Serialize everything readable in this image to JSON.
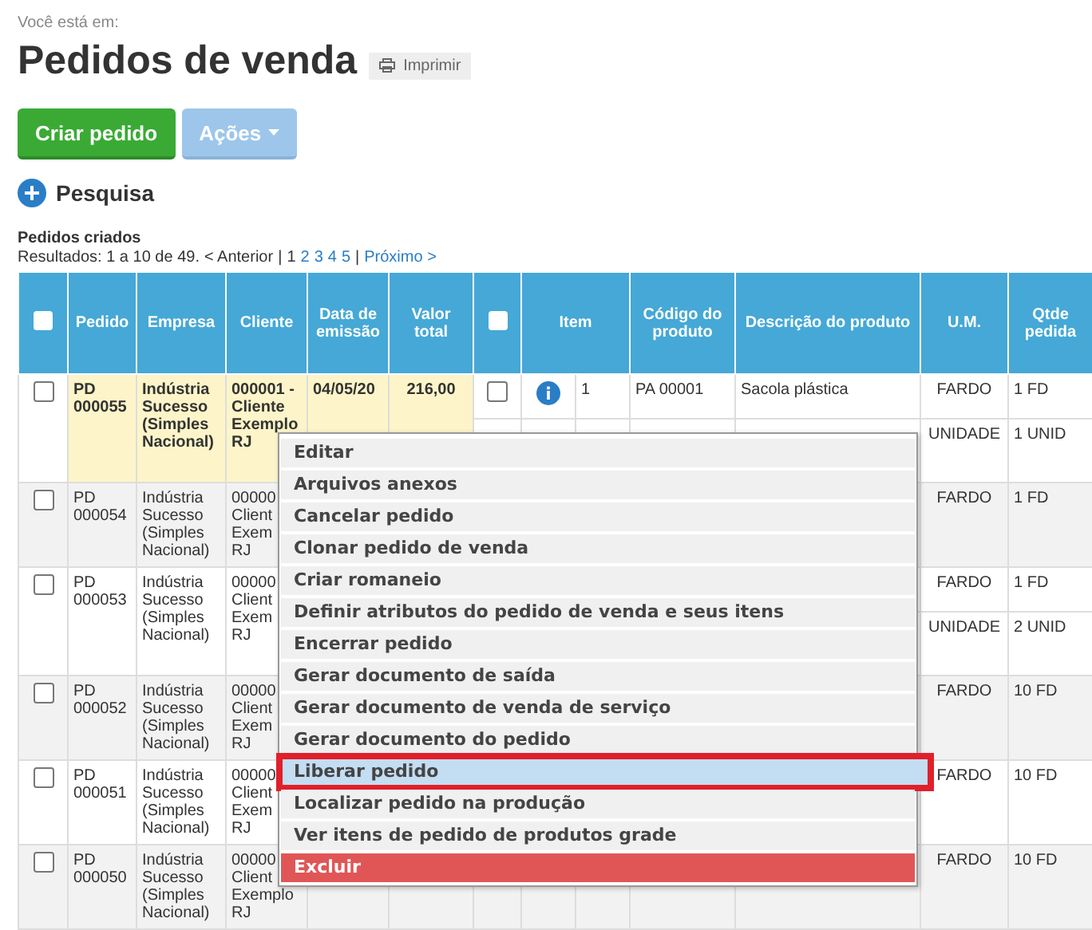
{
  "breadcrumb": "Você está em:",
  "title": "Pedidos de venda",
  "print_button": "Imprimir",
  "buttons": [
    {
      "label": "Criar pedido",
      "kind": "primary"
    },
    {
      "label": "Ações",
      "kind": "dropdown"
    }
  ],
  "search_toggle": "Pesquisa",
  "section_title": "Pedidos criados",
  "pagination": {
    "results": "Resultados: 1 a 10 de 49.",
    "previous": "< Anterior",
    "separators": [
      "|",
      "|"
    ],
    "pages": [
      {
        "label": "1",
        "selected": true
      },
      {
        "label": "2",
        "selected": false
      },
      {
        "label": "3",
        "selected": false
      },
      {
        "label": "4",
        "selected": false
      },
      {
        "label": "5",
        "selected": false
      }
    ],
    "next": "Próximo >"
  },
  "table": {
    "header_checked": false,
    "item_header_checked": false,
    "columns": [
      "Pedido",
      "Empresa",
      "Cliente",
      "Data de emissão",
      "Valor total",
      "Item",
      "Código do produto",
      "Descrição do produto",
      "U.M.",
      "Qtde pedida"
    ],
    "rows": [
      {
        "checked": false,
        "highlighted": true,
        "pedido": "PD 000055",
        "empresa": "Indústria Sucesso (Simples Nacional)",
        "cliente": [
          "000001 -",
          "Cliente",
          "Exemplo",
          "RJ"
        ],
        "data": "04/05/20",
        "valor": "216,00",
        "items": [
          {
            "checked": false,
            "info": true,
            "item": "1",
            "codigo": "PA 00001",
            "descricao": "Sacola plástica",
            "um": "FARDO",
            "qtde": "1 FD"
          },
          {
            "um": "UNIDADE",
            "qtde": "1 UNID"
          }
        ]
      },
      {
        "checked": false,
        "highlighted": false,
        "pedido": "PD 000054",
        "empresa": "Indústria Sucesso (Simples Nacional)",
        "cliente": [
          "00000",
          "Client",
          "Exem",
          "RJ"
        ],
        "items": [
          {
            "um": "FARDO",
            "qtde": "1 FD"
          }
        ]
      },
      {
        "checked": false,
        "highlighted": false,
        "pedido": "PD 000053",
        "empresa": "Indústria Sucesso (Simples Nacional)",
        "cliente": [
          "00000",
          "Client",
          "Exem",
          "RJ"
        ],
        "items": [
          {
            "um": "FARDO",
            "qtde": "1 FD"
          },
          {
            "um": "UNIDADE",
            "qtde": "2 UNID"
          }
        ]
      },
      {
        "checked": false,
        "highlighted": false,
        "pedido": "PD 000052",
        "empresa": "Indústria Sucesso (Simples Nacional)",
        "cliente": [
          "00000",
          "Client",
          "Exem",
          "RJ"
        ],
        "items": [
          {
            "um": "FARDO",
            "qtde": "10 FD"
          }
        ]
      },
      {
        "checked": false,
        "highlighted": false,
        "pedido": "PD 000051",
        "empresa": "Indústria Sucesso (Simples Nacional)",
        "cliente": [
          "00000",
          "Client",
          "Exem",
          "RJ"
        ],
        "items": [
          {
            "um": "FARDO",
            "qtde": "10 FD"
          }
        ]
      },
      {
        "checked": false,
        "highlighted": false,
        "pedido": "PD 000050",
        "empresa": "Indústria Sucesso (Simples Nacional)",
        "cliente": [
          "00000",
          "Client",
          "Exemplo",
          "RJ"
        ],
        "items": [
          {
            "um": "FARDO",
            "qtde": "10 FD"
          }
        ]
      }
    ]
  },
  "context_menu": [
    {
      "label": "Editar",
      "kind": "normal",
      "selected": false
    },
    {
      "label": "Arquivos anexos",
      "kind": "normal",
      "selected": false
    },
    {
      "label": "Cancelar pedido",
      "kind": "normal",
      "selected": false
    },
    {
      "label": "Clonar pedido de venda",
      "kind": "normal",
      "selected": false
    },
    {
      "label": "Criar romaneio",
      "kind": "normal",
      "selected": false
    },
    {
      "label": "Definir atributos do pedido de venda e seus itens",
      "kind": "normal",
      "selected": false
    },
    {
      "label": "Encerrar pedido",
      "kind": "normal",
      "selected": false
    },
    {
      "label": "Gerar documento de saída",
      "kind": "normal",
      "selected": false
    },
    {
      "label": "Gerar documento de venda de serviço",
      "kind": "normal",
      "selected": false
    },
    {
      "label": "Gerar documento do pedido",
      "kind": "normal",
      "selected": false
    },
    {
      "label": "Liberar pedido",
      "kind": "normal",
      "selected": true
    },
    {
      "label": "Localizar pedido na produção",
      "kind": "normal",
      "selected": false
    },
    {
      "label": "Ver itens de pedido de produtos grade",
      "kind": "normal",
      "selected": false
    },
    {
      "label": "Excluir",
      "kind": "danger",
      "selected": false
    }
  ]
}
